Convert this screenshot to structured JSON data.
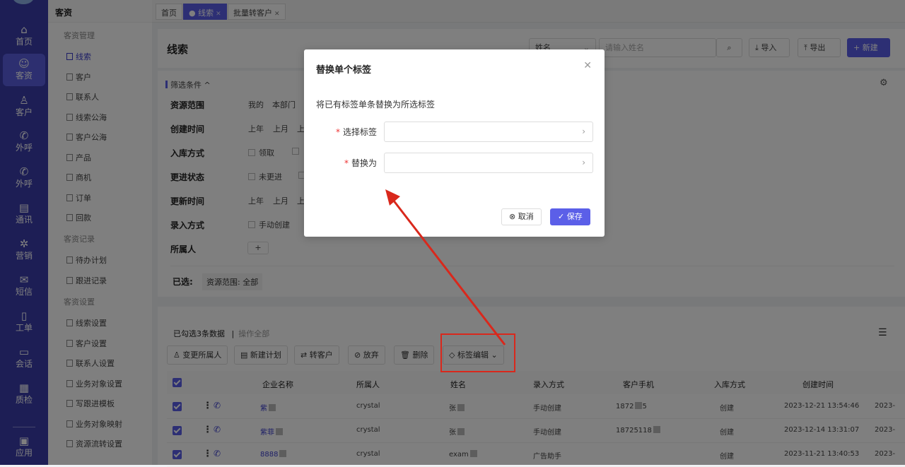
{
  "nav": {
    "items": [
      {
        "label": "首页",
        "icon": "home-icon",
        "glyph": "⌂"
      },
      {
        "label": "客资",
        "icon": "users-icon",
        "glyph": "☺"
      },
      {
        "label": "客户",
        "icon": "user-icon",
        "glyph": "♙"
      },
      {
        "label": "外呼",
        "icon": "phone-out-icon",
        "glyph": "✆"
      },
      {
        "label": "外呼",
        "icon": "phone-in-icon",
        "glyph": "✆"
      },
      {
        "label": "通讯",
        "icon": "contacts-icon",
        "glyph": "▤"
      },
      {
        "label": "营销",
        "icon": "gear-icon",
        "glyph": "✲"
      },
      {
        "label": "短信",
        "icon": "message-icon",
        "glyph": "✉"
      },
      {
        "label": "工单",
        "icon": "clipboard-icon",
        "glyph": "▯"
      },
      {
        "label": "会话",
        "icon": "chat-icon",
        "glyph": "▭"
      },
      {
        "label": "质检",
        "icon": "calendar-icon",
        "glyph": "▦"
      },
      {
        "label": "应用",
        "icon": "apps-icon",
        "glyph": "▣"
      }
    ]
  },
  "submenu": {
    "title": "客资",
    "group1": "客资管理",
    "items1": [
      "线索",
      "客户",
      "联系人",
      "线索公海",
      "客户公海",
      "产品",
      "商机",
      "订单",
      "回款"
    ],
    "group2": "客资记录",
    "items2": [
      "待办计划",
      "跟进记录"
    ],
    "group3": "客资设置",
    "items3": [
      "线索设置",
      "客户设置",
      "联系人设置",
      "业务对象设置",
      "写跟进模板",
      "业务对象映射",
      "资源流转设置"
    ]
  },
  "tabs": [
    "首页",
    "线索",
    "批量转客户"
  ],
  "header": {
    "title": "线索",
    "field_select": "姓名",
    "search_placeholder": "请输入姓名",
    "import": "导入",
    "export": "导出",
    "new": "新建"
  },
  "filter": {
    "toggle": "筛选条件",
    "labels": [
      "资源范围",
      "创建时间",
      "入库方式",
      "更进状态",
      "更新时间",
      "录入方式",
      "所属人"
    ],
    "scope_opts": [
      "我的",
      "本部门"
    ],
    "time_opts": [
      "上年",
      "上月",
      "上"
    ],
    "inbound_opts": [
      "领取"
    ],
    "status_opts": [
      "未更进"
    ],
    "update_opts": [
      "上年",
      "上月",
      "上"
    ],
    "entry_opts": [
      "手动创建"
    ],
    "owner_add": "+",
    "selected_label": "已选:",
    "selected_tag": "资源范围: 全部"
  },
  "list": {
    "selected_info": "已勾选3条数据",
    "op_all": "操作全部",
    "actions": [
      "变更所属人",
      "新建计划",
      "转客户",
      "放弃",
      "删除",
      "标签编辑"
    ],
    "columns": [
      "企业名称",
      "所属人",
      "姓名",
      "录入方式",
      "客户手机",
      "入库方式",
      "创建时间"
    ],
    "rows": [
      {
        "company": "紫",
        "owner": "crystal",
        "name": "张",
        "entry": "手动创建",
        "phone": "1872",
        "phone_tail": "5",
        "inbound": "创建",
        "created": "2023-12-21 13:54:46",
        "extra": "2023-"
      },
      {
        "company": "紫菲",
        "owner": "crystal",
        "name": "张",
        "entry": "手动创建",
        "phone": "18725118",
        "phone_tail": "",
        "inbound": "创建",
        "created": "2023-12-14 13:31:07",
        "extra": "2023-"
      },
      {
        "company": "8888",
        "owner": "crystal",
        "name": "exam",
        "entry": "广告助手",
        "phone": "",
        "phone_tail": "",
        "inbound": "创建",
        "created": "2023-11-21 13:40:53",
        "extra": "2023-"
      }
    ]
  },
  "modal": {
    "title": "替换单个标签",
    "desc": "将已有标签单条替换为所选标签",
    "field1": "选择标签",
    "field2": "替换为",
    "cancel": "取消",
    "save": "保存"
  },
  "colors": {
    "accent": "#5b5fe8",
    "nav": "#3a3dab",
    "annotation": "#d9281c"
  }
}
